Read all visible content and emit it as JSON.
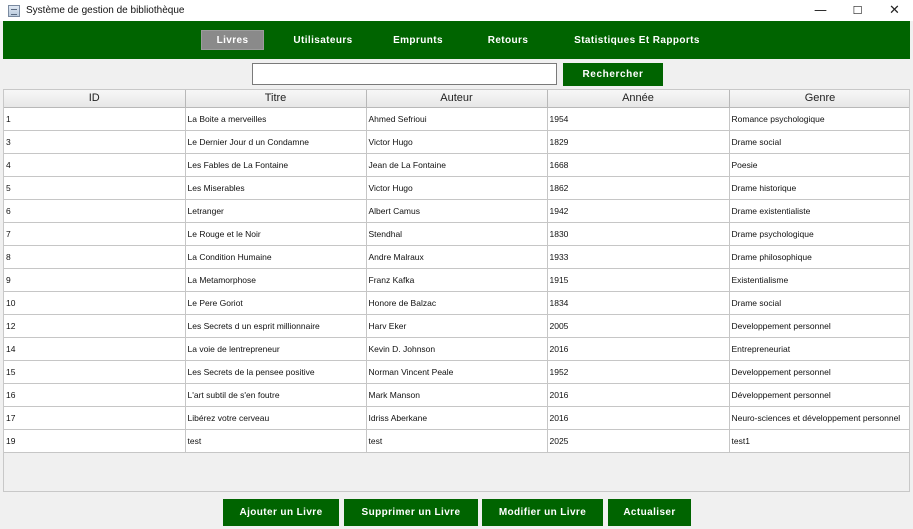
{
  "window": {
    "title": "Système de gestion de bibliothèque",
    "controls": {
      "minimize": "—",
      "maximize": "☐",
      "close": "✕"
    }
  },
  "nav": {
    "items": [
      {
        "label": "Livres",
        "active": true
      },
      {
        "label": "Utilisateurs",
        "active": false
      },
      {
        "label": "Emprunts",
        "active": false
      },
      {
        "label": "Retours",
        "active": false
      },
      {
        "label": "Statistiques Et Rapports",
        "active": false
      }
    ]
  },
  "search": {
    "value": "",
    "placeholder": "",
    "button_label": "Rechercher"
  },
  "table": {
    "columns": [
      "ID",
      "Titre",
      "Auteur",
      "Année",
      "Genre"
    ],
    "rows": [
      [
        "1",
        "La Boite a merveilles",
        "Ahmed Sefrioui",
        "1954",
        "Romance psychologique"
      ],
      [
        "3",
        "Le Dernier Jour d un Condamne",
        "Victor Hugo",
        "1829",
        "Drame social"
      ],
      [
        "4",
        "Les Fables de La Fontaine",
        "Jean de La Fontaine",
        "1668",
        "Poesie"
      ],
      [
        "5",
        "Les Miserables",
        "Victor Hugo",
        "1862",
        "Drame historique"
      ],
      [
        "6",
        "Letranger",
        "Albert Camus",
        "1942",
        "Drame existentialiste"
      ],
      [
        "7",
        "Le Rouge et le Noir",
        "Stendhal",
        "1830",
        "Drame psychologique"
      ],
      [
        "8",
        "La Condition Humaine",
        "Andre Malraux",
        "1933",
        "Drame philosophique"
      ],
      [
        "9",
        "La Metamorphose",
        "Franz Kafka",
        "1915",
        "Existentialisme"
      ],
      [
        "10",
        "Le Pere Goriot",
        "Honore de Balzac",
        "1834",
        "Drame social"
      ],
      [
        "12",
        "Les Secrets d un esprit millionnaire",
        "Harv Eker",
        "2005",
        "Developpement personnel"
      ],
      [
        "14",
        "La voie de lentrepreneur",
        "Kevin D. Johnson",
        "2016",
        "Entrepreneuriat"
      ],
      [
        "15",
        "Les Secrets de la pensee positive",
        "Norman Vincent Peale",
        "1952",
        "Developpement personnel"
      ],
      [
        "16",
        "L'art subtil de s'en foutre",
        "Mark Manson",
        "2016",
        "Développement personnel"
      ],
      [
        "17",
        "Libérez votre cerveau",
        "Idriss Aberkane",
        "2016",
        "Neuro-sciences et développement personnel"
      ],
      [
        "19",
        "test",
        "test",
        "2025",
        "test1"
      ]
    ]
  },
  "actions": {
    "add": "Ajouter un Livre",
    "delete": "Supprimer un Livre",
    "edit": "Modifier un Livre",
    "refresh": "Actualiser"
  },
  "colors": {
    "primary_green": "#006400",
    "active_tab": "#8a8a8a"
  }
}
